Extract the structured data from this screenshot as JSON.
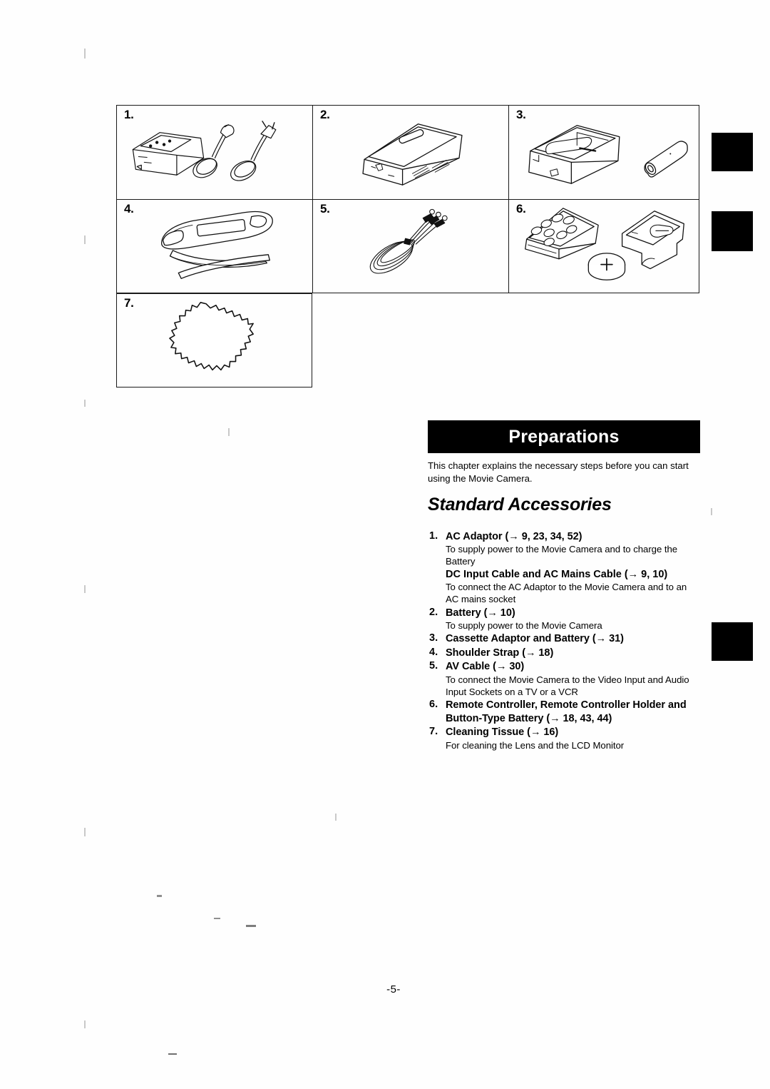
{
  "page": {
    "number_label": "-5-"
  },
  "accessory_grid": {
    "cells": [
      {
        "number": "1.",
        "icon": "ac-adaptor-and-cables-illustration"
      },
      {
        "number": "2.",
        "icon": "battery-pack-illustration"
      },
      {
        "number": "3.",
        "icon": "cassette-adaptor-and-battery-illustration"
      },
      {
        "number": "4.",
        "icon": "shoulder-strap-illustration"
      },
      {
        "number": "5.",
        "icon": "av-cable-illustration"
      },
      {
        "number": "6.",
        "icon": "remote-controller-holder-and-button-battery-illustration"
      },
      {
        "number": "7.",
        "icon": "cleaning-tissue-illustration"
      }
    ]
  },
  "chapter": {
    "banner_title": "Preparations",
    "intro": "This chapter explains the necessary steps before you can start using the Movie Camera.",
    "section_title": "Standard Accessories"
  },
  "accessories": [
    {
      "index": "1.",
      "heading": "AC Adaptor (→ 9, 23, 34, 52)",
      "description": "To supply power to the Movie Camera and to charge the Battery",
      "subheading": "DC Input Cable and AC Mains Cable (→ 9, 10)",
      "subdescription": "To connect the AC Adaptor to the Movie Camera and to an AC mains socket"
    },
    {
      "index": "2.",
      "heading": "Battery (→ 10)",
      "description": "To supply power to the Movie Camera"
    },
    {
      "index": "3.",
      "heading": "Cassette Adaptor and Battery (→ 31)",
      "description": ""
    },
    {
      "index": "4.",
      "heading": "Shoulder Strap (→ 18)",
      "description": ""
    },
    {
      "index": "5.",
      "heading": "AV Cable (→ 30)",
      "description": "To connect the Movie Camera to the Video Input and Audio Input Sockets on a TV or a VCR"
    },
    {
      "index": "6.",
      "heading": "Remote Controller, Remote Controller Holder and Button-Type Battery (→ 18, 43, 44)",
      "description": ""
    },
    {
      "index": "7.",
      "heading": "Cleaning Tissue (→ 16)",
      "description": "For cleaning the Lens and the LCD Monitor"
    }
  ],
  "index_tabs": [
    {
      "name": "index-tab-top"
    },
    {
      "name": "index-tab-second"
    },
    {
      "name": "index-tab-preparations"
    }
  ],
  "colors": {
    "ink": "#000000",
    "paper": "#ffffff",
    "banner_bg": "#000000",
    "banner_text": "#ffffff"
  }
}
